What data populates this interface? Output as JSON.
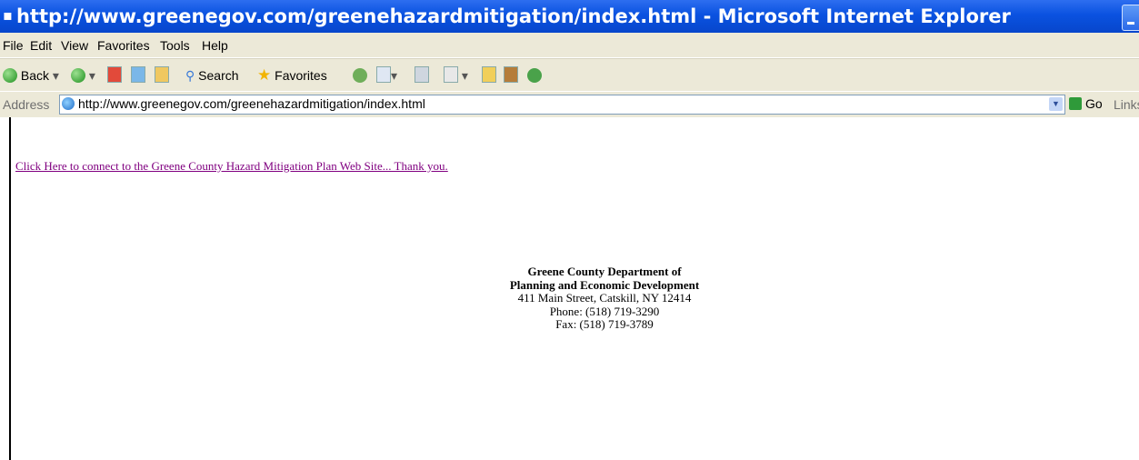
{
  "window": {
    "title": "http://www.greenegov.com/greenehazardmitigation/index.html - Microsoft Internet Explorer"
  },
  "menu": [
    "File",
    "Edit",
    "View",
    "Favorites",
    "Tools",
    "Help"
  ],
  "toolbar": {
    "back": "Back",
    "search": "Search",
    "favorites": "Favorites"
  },
  "address": {
    "label": "Address",
    "url": "http://www.greenegov.com/greenehazardmitigation/index.html",
    "go": "Go",
    "links": "Links"
  },
  "page": {
    "link_text": "Click Here to connect to the Greene County Hazard Mitigation Plan Web Site... Thank you.",
    "org_line1": "Greene County Department of",
    "org_line2": "Planning and Economic Development",
    "street": "411 Main Street, Catskill, NY 12414",
    "phone": "Phone: (518) 719-3290",
    "fax": "Fax: (518) 719-3789"
  },
  "colors": {
    "titlebar": "#0a52e0",
    "visited_link": "#800080"
  }
}
